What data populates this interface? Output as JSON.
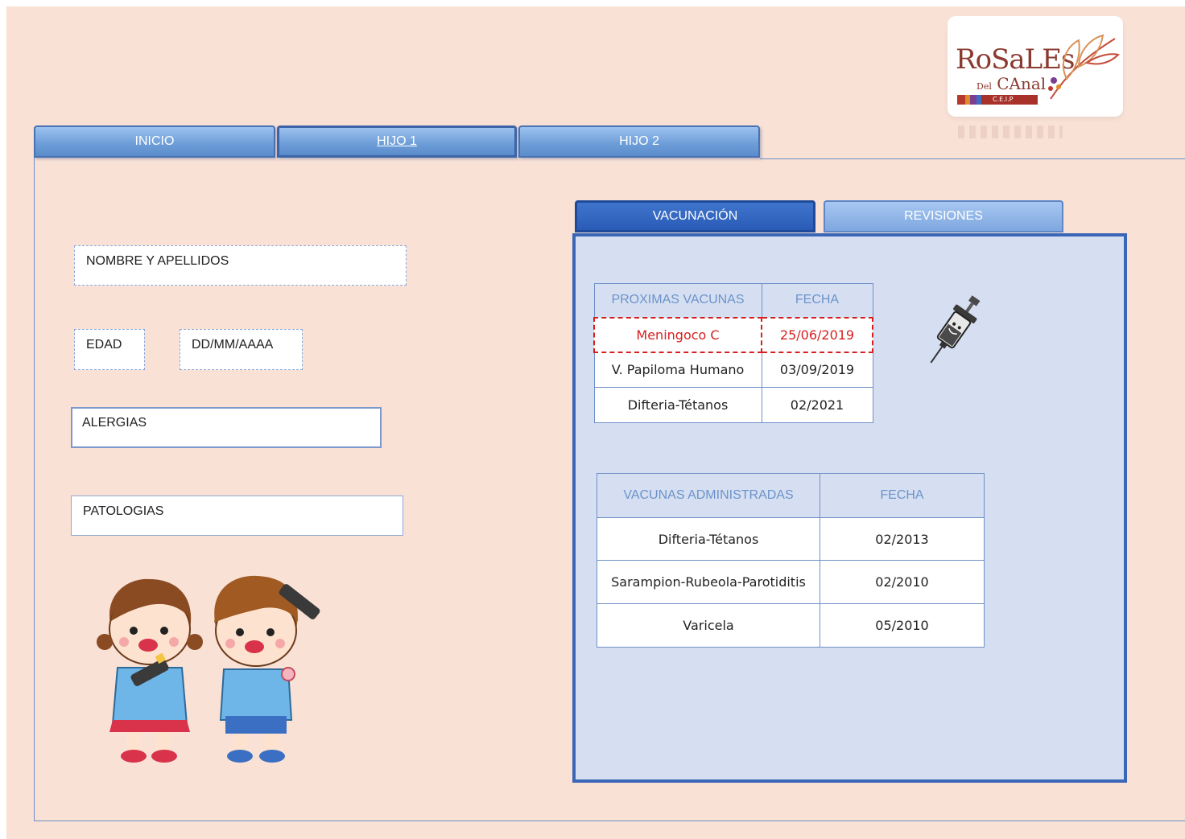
{
  "logo": {
    "line1": "RoSaLEs",
    "line2_small": "Del",
    "line2": "CAnal",
    "tag": "C.E.I.P",
    "colors": [
      "#b63a2c",
      "#e08a2a",
      "#7a3f8f",
      "#3d6cc2",
      "#c0392b"
    ]
  },
  "nav": {
    "tabs": [
      {
        "label": "INICIO"
      },
      {
        "label": "HIJO 1"
      },
      {
        "label": "HIJO 2"
      }
    ],
    "active_index": 1
  },
  "form": {
    "name_label": "NOMBRE Y APELLIDOS",
    "age_label": "EDAD",
    "date_placeholder": "DD/MM/AAAA",
    "allergies_label": "ALERGIAS",
    "pathologies_label": "PATOLOGIAS"
  },
  "sections": {
    "tabs": [
      {
        "label": "VACUNACIÓN"
      },
      {
        "label": "REVISIONES"
      }
    ],
    "active": "VACUNACIÓN"
  },
  "upcoming": {
    "headers": [
      "PROXIMAS VACUNAS",
      "FECHA"
    ],
    "rows": [
      {
        "vaccine": "Meningoco C",
        "date": "25/06/2019",
        "highlight": true
      },
      {
        "vaccine": "V. Papiloma Humano",
        "date": "03/09/2019"
      },
      {
        "vaccine": "Difteria-Tétanos",
        "date": "02/2021"
      }
    ]
  },
  "administered": {
    "headers": [
      "VACUNAS ADMINISTRADAS",
      "FECHA"
    ],
    "rows": [
      {
        "vaccine": "Difteria-Tétanos",
        "date": "02/2013"
      },
      {
        "vaccine": "Sarampion-Rubeola-Parotiditis",
        "date": "02/2010"
      },
      {
        "vaccine": "Varicela",
        "date": "05/2010"
      }
    ]
  },
  "theme": {
    "page_bg": "#f9e1d6",
    "panel_bg": "#d6dff2",
    "accent": "#3a66b8",
    "highlight": "#d62020",
    "header_text": "#6b93c9"
  },
  "icons": [
    "syringe-icon",
    "kids-illustration"
  ]
}
